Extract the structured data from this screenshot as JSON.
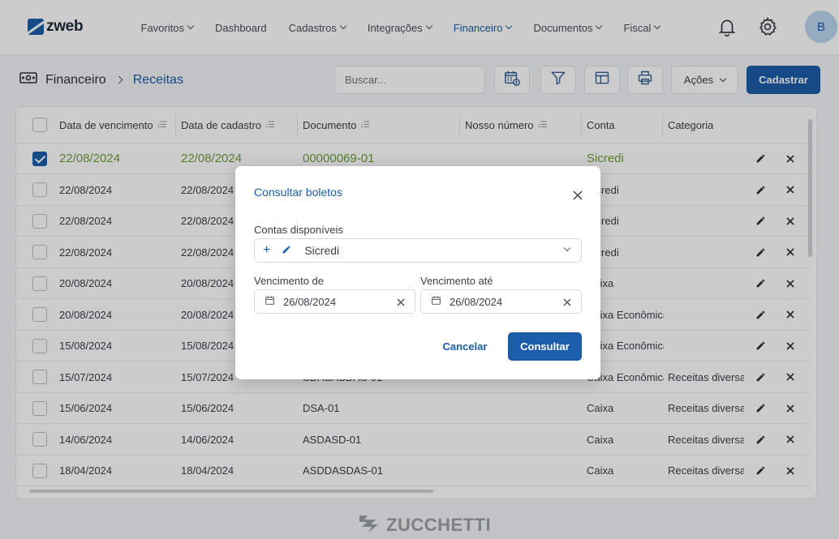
{
  "app": {
    "logo_text": "zweb",
    "avatar_initial": "B"
  },
  "nav": [
    {
      "label": "Favoritos",
      "caret": true,
      "active": false
    },
    {
      "label": "Dashboard",
      "caret": false,
      "active": false
    },
    {
      "label": "Cadastros",
      "caret": true,
      "active": false
    },
    {
      "label": "Integrações",
      "caret": true,
      "active": false
    },
    {
      "label": "Financeiro",
      "caret": true,
      "active": true
    },
    {
      "label": "Documentos",
      "caret": true,
      "active": false
    },
    {
      "label": "Fiscal",
      "caret": true,
      "active": false
    }
  ],
  "breadcrumb": {
    "root": "Financeiro",
    "current": "Receitas"
  },
  "toolbar": {
    "search_placeholder": "Buscar...",
    "acoes_label": "Ações",
    "cadastrar_label": "Cadastrar"
  },
  "table": {
    "columns": [
      "Data de vencimento",
      "Data de cadastro",
      "Documento",
      "Nosso número",
      "Conta",
      "Categoria"
    ],
    "rows": [
      {
        "venc": "22/08/2024",
        "cad": "22/08/2024",
        "doc": "00000069-01",
        "nosso": "",
        "conta": "Sicredi",
        "cat": "",
        "checked": true
      },
      {
        "venc": "22/08/2024",
        "cad": "22/08/2024",
        "doc": "",
        "nosso": "",
        "conta": "Sicredi",
        "cat": "",
        "checked": false
      },
      {
        "venc": "22/08/2024",
        "cad": "22/08/2024",
        "doc": "",
        "nosso": "",
        "conta": "Sicredi",
        "cat": "",
        "checked": false
      },
      {
        "venc": "22/08/2024",
        "cad": "22/08/2024",
        "doc": "",
        "nosso": "",
        "conta": "Sicredi",
        "cat": "",
        "checked": false
      },
      {
        "venc": "20/08/2024",
        "cad": "20/08/2024",
        "doc": "",
        "nosso": "",
        "conta": "Caixa",
        "cat": "",
        "checked": false
      },
      {
        "venc": "20/08/2024",
        "cad": "20/08/2024",
        "doc": "",
        "nosso": "",
        "conta": "Caixa Econômica",
        "cat": "",
        "checked": false
      },
      {
        "venc": "15/08/2024",
        "cad": "15/08/2024",
        "doc": "",
        "nosso": "",
        "conta": "Caixa Econômica",
        "cat": "",
        "checked": false
      },
      {
        "venc": "15/07/2024",
        "cad": "15/07/2024",
        "doc": "SDASASDAS-01",
        "nosso": "",
        "conta": "Caixa Econômica",
        "cat": "Receitas diversas",
        "checked": false
      },
      {
        "venc": "15/06/2024",
        "cad": "15/06/2024",
        "doc": "DSA-01",
        "nosso": "",
        "conta": "Caixa",
        "cat": "Receitas diversas",
        "checked": false
      },
      {
        "venc": "14/06/2024",
        "cad": "14/06/2024",
        "doc": "ASDASD-01",
        "nosso": "",
        "conta": "Caixa",
        "cat": "Receitas diversas",
        "checked": false
      },
      {
        "venc": "18/04/2024",
        "cad": "18/04/2024",
        "doc": "ASDDASDAS-01",
        "nosso": "",
        "conta": "Caixa",
        "cat": "Receitas diversas",
        "checked": false
      }
    ]
  },
  "footer": {
    "brand": "ZUCCHETTI"
  },
  "modal": {
    "title": "Consultar boletos",
    "contas_label": "Contas disponíveis",
    "conta_value": "Sicredi",
    "venc_de_label": "Vencimento de",
    "venc_de_value": "26/08/2024",
    "venc_ate_label": "Vencimento até",
    "venc_ate_value": "26/08/2024",
    "cancel_label": "Cancelar",
    "submit_label": "Consultar"
  },
  "colors": {
    "primary": "#1b5da8",
    "selected_text": "#6e9c3a"
  }
}
